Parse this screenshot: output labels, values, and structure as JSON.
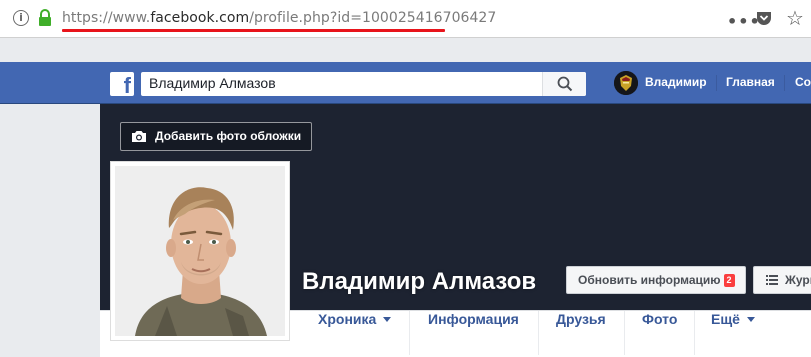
{
  "browser": {
    "url_prefix": "https://www.",
    "url_domain": "facebook.com",
    "url_path": "/profile.php?id=100025416706427",
    "more_icon": "more-horizontal-icon",
    "pocket_icon": "pocket-icon",
    "star_icon": "star-icon"
  },
  "fbbar": {
    "search_value": "Владимир Алмазов",
    "user_name": "Владимир",
    "home_label": "Главная",
    "create_label": "Созд",
    "accent": "#4267b2"
  },
  "cover": {
    "add_cover_label": "Добавить фото обложки",
    "profile_name": "Владимир Алмазов",
    "update_info_label": "Обновить информацию",
    "update_badge": "2",
    "log_label": "Журнал",
    "background": "#1d2331"
  },
  "tabs": [
    {
      "label": "Хроника"
    },
    {
      "label": "Информация"
    },
    {
      "label": "Друзья"
    },
    {
      "label": "Фото"
    },
    {
      "label": "Ещё"
    }
  ]
}
